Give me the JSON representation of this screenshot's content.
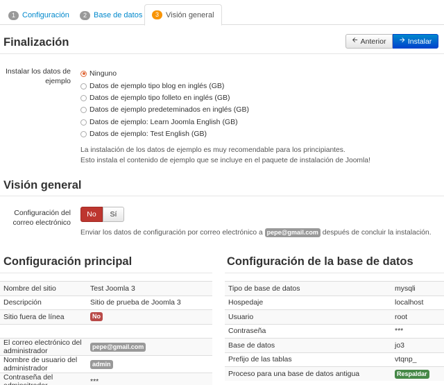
{
  "tabs": [
    {
      "num": "1",
      "label": "Configuración"
    },
    {
      "num": "2",
      "label": "Base de datos"
    },
    {
      "num": "3",
      "label": "Visión general"
    }
  ],
  "header": {
    "title": "Finalización",
    "prev_label": "Anterior",
    "install_label": "Instalar",
    "prev_icon": "arrow-left-icon",
    "install_icon": "arrow-right-icon"
  },
  "sample_data": {
    "label": "Instalar los datos de ejemplo",
    "selected": "Ninguno",
    "options": [
      "Ninguno",
      "Datos de ejemplo tipo blog en inglés (GB)",
      "Datos de ejemplo tipo folleto en inglés (GB)",
      "Datos de ejemplo predeteminados en inglés (GB)",
      "Datos de ejemplo: Learn Joomla English (GB)",
      "Datos de ejemplo: Test English (GB)"
    ],
    "help_line1": "La instalación de los datos de ejemplo es muy recomendable para los principiantes.",
    "help_line2": "Esto instala el contenido de ejemplo que se incluye en el paquete de instalación de Joomla!"
  },
  "overview": {
    "title": "Visión general",
    "email_config_label": "Configuración del correo electrónico",
    "no_label": "No",
    "si_label": "Sí",
    "selected": "No",
    "help_before": "Enviar los datos de configuración por correo electrónico a",
    "help_email": "pepe@gmail.com",
    "help_after": "después de concluir la instalación."
  },
  "main_config": {
    "title": "Configuración principal",
    "rows": [
      {
        "key": "Nombre del sitio",
        "value": "Test Joomla 3",
        "kind": "text"
      },
      {
        "key": "Descripción",
        "value": "Sitio de prueba de Joomla 3",
        "kind": "text"
      },
      {
        "key": "Sitio fuera de línea",
        "value": "No",
        "kind": "badge-red"
      },
      {
        "key": "",
        "value": "",
        "kind": "blank"
      },
      {
        "key": "El correo electrónico del administrador",
        "value": "pepe@gmail.com",
        "kind": "badge"
      },
      {
        "key": "Nombre de usuario del administrador",
        "value": "admin",
        "kind": "badge"
      },
      {
        "key": "Contraseña del adminsitrador",
        "value": "***",
        "kind": "text"
      }
    ]
  },
  "db_config": {
    "title": "Configuración de la base de datos",
    "rows": [
      {
        "key": "Tipo de base de datos",
        "value": "mysqli",
        "kind": "text"
      },
      {
        "key": "Hospedaje",
        "value": "localhost",
        "kind": "text"
      },
      {
        "key": "Usuario",
        "value": "root",
        "kind": "text"
      },
      {
        "key": "Contraseña",
        "value": "***",
        "kind": "text"
      },
      {
        "key": "Base de datos",
        "value": "jo3",
        "kind": "text"
      },
      {
        "key": "Prefijo de las tablas",
        "value": "vtqnp_",
        "kind": "text"
      },
      {
        "key": "Proceso para una base de datos antigua",
        "value": "Respaldar",
        "kind": "badge-green"
      }
    ]
  },
  "colors": {
    "link": "#0088cc",
    "primary": "#0055cc",
    "active_step": "#f89406",
    "danger": "#bd362f",
    "success": "#468847",
    "badge": "#999999"
  }
}
